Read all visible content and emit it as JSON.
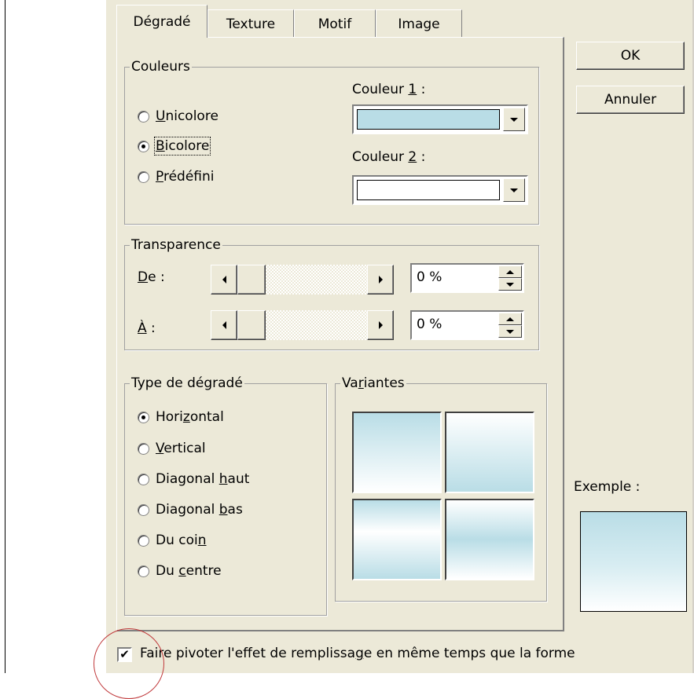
{
  "tabs": [
    "Dégradé",
    "Texture",
    "Motif",
    "Image"
  ],
  "buttons": {
    "ok": "OK",
    "cancel": "Annuler"
  },
  "colors_group": {
    "legend": "Couleurs",
    "radios": [
      {
        "pre": "",
        "key": "U",
        "post": "nicolore",
        "checked": false
      },
      {
        "pre": "",
        "key": "B",
        "post": "icolore",
        "checked": true
      },
      {
        "pre": "",
        "key": "P",
        "post": "rédéfini",
        "checked": false
      }
    ],
    "color1_label": {
      "pre": "Couleur ",
      "key": "1",
      "post": " :"
    },
    "color1_value": "#b9dde6",
    "color2_label": {
      "pre": "Couleur ",
      "key": "2",
      "post": " :"
    },
    "color2_value": "#ffffff"
  },
  "transparency_group": {
    "legend": "Transparence",
    "from_label": {
      "key": "D",
      "post": "e :"
    },
    "to_label": {
      "key": "À",
      "post": " :"
    },
    "from_value": "0 %",
    "to_value": "0 %"
  },
  "gradient_type_group": {
    "legend": "Type de dégradé",
    "options": [
      {
        "pre": "Hori",
        "key": "z",
        "post": "ontal",
        "checked": true
      },
      {
        "pre": "",
        "key": "V",
        "post": "ertical",
        "checked": false
      },
      {
        "pre": "Diagonal ",
        "key": "h",
        "post": "aut",
        "checked": false
      },
      {
        "pre": "Diagonal ",
        "key": "b",
        "post": "as",
        "checked": false
      },
      {
        "pre": "Du coi",
        "key": "n",
        "post": "",
        "checked": false
      },
      {
        "pre": "Du ",
        "key": "c",
        "post": "entre",
        "checked": false
      }
    ]
  },
  "variants_group": {
    "legend_pre": "Va",
    "legend_key": "r",
    "legend_post": "iantes"
  },
  "example_label": "Exemple :",
  "rotate_checkbox": {
    "pre": "Faire pivoter l'effet de remplissa",
    "key": "g",
    "post": "e en même temps que la forme",
    "checked": true
  },
  "accent_colors": {
    "gradient_light_blue": "#b9dde6",
    "annotation_circle": "#c0393b"
  }
}
